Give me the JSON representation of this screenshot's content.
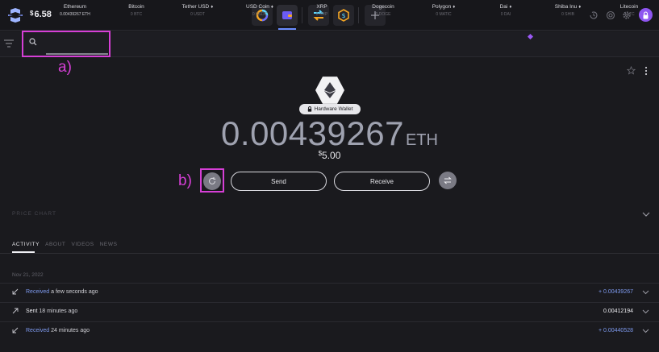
{
  "app": {
    "balance_currency": "$",
    "balance_value": "6.58"
  },
  "topbar": {
    "icons": [
      "portfolio-ring-icon",
      "wallet-icon",
      "exchange-icon",
      "dollar-coin-icon",
      "plus-icon",
      "history-icon",
      "support-icon",
      "gear-icon",
      "lock-icon"
    ]
  },
  "assets": [
    {
      "name": "Ethereum",
      "amount": "0.00439267 ETH",
      "selected": true
    },
    {
      "name": "Bitcoin",
      "amount": "0 BTC"
    },
    {
      "name": "Tether USD",
      "amount": "0 USDT",
      "dot": "♦"
    },
    {
      "name": "USD Coin",
      "amount": "0 USDC",
      "dot": "♦"
    },
    {
      "name": "XRP",
      "amount": "0 XRP"
    },
    {
      "name": "Dogecoin",
      "amount": "0 DOGE"
    },
    {
      "name": "Polygon",
      "amount": "0 MATIC",
      "dot": "♦"
    },
    {
      "name": "Dai",
      "amount": "0 DAI",
      "dot": "♦"
    },
    {
      "name": "Shiba Inu",
      "amount": "0 SHIB",
      "dot": "♦"
    },
    {
      "name": "Litecoin",
      "amount": "0 LTC"
    }
  ],
  "annotations": {
    "a": "a)",
    "b": "b)"
  },
  "asset_detail": {
    "wallet_label": "Hardware Wallet",
    "amount": "0.00439267",
    "unit": "ETH",
    "fiat_currency": "$",
    "fiat_value": "5.00",
    "send_label": "Send",
    "receive_label": "Receive"
  },
  "price_chart_label": "PRICE CHART",
  "tabs": [
    "ACTIVITY",
    "ABOUT",
    "VIDEOS",
    "NEWS"
  ],
  "activity": {
    "date": "Nov 21, 2022",
    "rows": [
      {
        "kind": "Received",
        "time": "a few seconds ago",
        "amount": "+ 0.00439267",
        "direction": "in"
      },
      {
        "kind": "Sent",
        "time": "18 minutes ago",
        "amount": "0.00412194",
        "direction": "out"
      },
      {
        "kind": "Received",
        "time": "24 minutes ago",
        "amount": "+ 0.00440528",
        "direction": "in"
      }
    ]
  },
  "colors": {
    "accent": "#8e55f0",
    "highlight": "#d63fd6",
    "received": "#7e9aee",
    "link": "#6a8cff"
  }
}
